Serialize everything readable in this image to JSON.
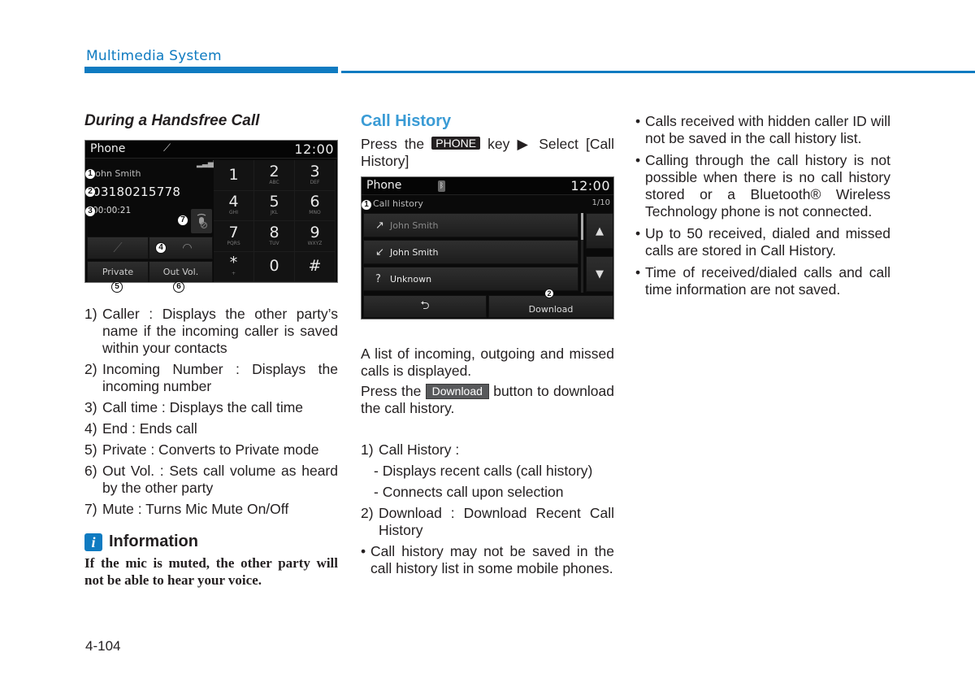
{
  "header": {
    "section_title": "Multimedia System",
    "accent_color": "#0f7bc1"
  },
  "handsfree": {
    "heading": "During a Handsfree Call",
    "screen": {
      "title": "Phone",
      "clock": "12:00",
      "caller_name": "John Smith",
      "caller_number": "03180215778",
      "call_time": "00:00:21",
      "private_label": "Private",
      "out_vol_label": "Out Vol.",
      "keys": [
        {
          "d": "1",
          "l": ""
        },
        {
          "d": "2",
          "l": "ABC"
        },
        {
          "d": "3",
          "l": "DEF"
        },
        {
          "d": "4",
          "l": "GHI"
        },
        {
          "d": "5",
          "l": "JKL"
        },
        {
          "d": "6",
          "l": "MNO"
        },
        {
          "d": "7",
          "l": "PQRS"
        },
        {
          "d": "8",
          "l": "TUV"
        },
        {
          "d": "9",
          "l": "WXYZ"
        },
        {
          "d": "*",
          "l": "+"
        },
        {
          "d": "0",
          "l": ""
        },
        {
          "d": "#",
          "l": ""
        }
      ],
      "markers": [
        "1",
        "2",
        "3",
        "4",
        "5",
        "6",
        "7"
      ]
    },
    "items": [
      {
        "n": "1)",
        "t": "Caller : Displays the other party’s name if the incoming caller is saved within your contacts"
      },
      {
        "n": "2)",
        "t": "Incoming Number : Displays the incoming number"
      },
      {
        "n": "3)",
        "t": "Call time : Displays the call time"
      },
      {
        "n": "4)",
        "t": "End : Ends call"
      },
      {
        "n": "5)",
        "t": "Private : Converts to Private mode"
      },
      {
        "n": "6)",
        "t": "Out Vol. : Sets call volume as heard by the other party"
      },
      {
        "n": "7)",
        "t": "Mute : Turns Mic Mute On/Off"
      }
    ],
    "info": {
      "icon_letter": "i",
      "title": "Information",
      "text": "If the mic is muted, the other party will not be able to hear your voice."
    }
  },
  "call_history": {
    "heading": "Call History",
    "instr_pre": "Press the ",
    "instr_key": "PHONE",
    "instr_mid": " key ▶ Select [Call History]",
    "screen": {
      "title": "Phone",
      "clock": "12:00",
      "list_label": "Call history",
      "page_indicator": "1/10",
      "rows": [
        {
          "type": "outgoing",
          "name": "John Smith"
        },
        {
          "type": "incoming",
          "name": "John Smith"
        },
        {
          "type": "missed",
          "name": "Unknown"
        }
      ],
      "download_label": "Download",
      "markers": [
        "1",
        "2"
      ]
    },
    "desc": "A list of incoming, outgoing and missed calls is displayed.",
    "dl_pre": "Press the ",
    "dl_btn": "Download",
    "dl_post": " button to download the call history.",
    "items": [
      {
        "n": "1)",
        "t": "Call History :"
      },
      {
        "dash": "- Displays recent calls (call history)"
      },
      {
        "dash": "- Connects call upon selection"
      },
      {
        "n": "2)",
        "t": "Download : Download Recent Call History"
      }
    ],
    "bullet": "Call history may not be saved in the call history list in some mobile phones."
  },
  "notes": [
    "Calls received with hidden caller ID will not be saved in the call history list.",
    "Calling through the call history is not possible when there is no call history stored or a Bluetooth® Wireless Technology phone is not connected.",
    "Up to 50 received, dialed and missed calls are stored in Call History.",
    "Time of received/dialed calls and call time information are not saved."
  ],
  "page_number": "4-104"
}
